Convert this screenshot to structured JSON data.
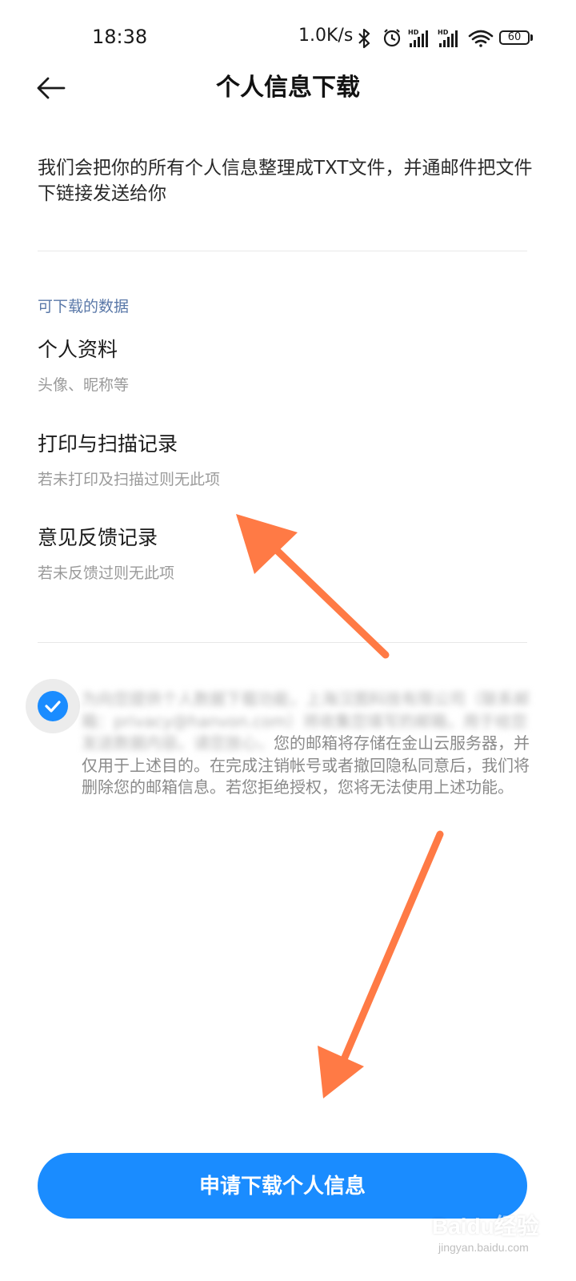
{
  "status_bar": {
    "time": "18:38",
    "network_speed": "1.0K/s",
    "battery_level": "60",
    "icons": [
      "bluetooth-icon",
      "alarm-icon",
      "hd-signal-icon",
      "hd-signal-icon",
      "wifi-icon",
      "battery-icon"
    ]
  },
  "header": {
    "back_icon": "arrow-left-icon",
    "title": "个人信息下载"
  },
  "intro": {
    "text": "我们会把你的所有个人信息整理成TXT文件，并通邮件把文件下链接发送给你"
  },
  "data_section": {
    "label": "可下载的数据",
    "items": [
      {
        "title": "个人资料",
        "description": "头像、昵称等"
      },
      {
        "title": "打印与扫描记录",
        "description": "若未打印及扫描过则无此项"
      },
      {
        "title": "意见反馈记录",
        "description": "若未反馈过则无此项"
      }
    ]
  },
  "consent": {
    "checked": true,
    "text_blurred_1": "为向您提供个人数据下载功能，上海汉图科技有限公司（联系",
    "text_blurred_2": "邮箱：privacy@hanvon.com）将收集您填写的邮箱，用于给",
    "text_blurred_3": "您发送数据内容。请您放心，",
    "text_visible_1": "您的邮箱将存储在金山云服务器，并仅用于上述目的。在完成注销帐号或者撤回隐私同意后，我们将删除您的邮箱信息。若您拒绝授权，您将无法使用上述功能。"
  },
  "primary_button": {
    "label": "申请下载个人信息"
  },
  "watermark": {
    "main": "Baidu经验",
    "sub": "jingyan.baidu.com"
  },
  "colors": {
    "accent": "#1a8cff",
    "annotation_arrow": "#ff7a45",
    "section_label": "#5a78a8"
  }
}
